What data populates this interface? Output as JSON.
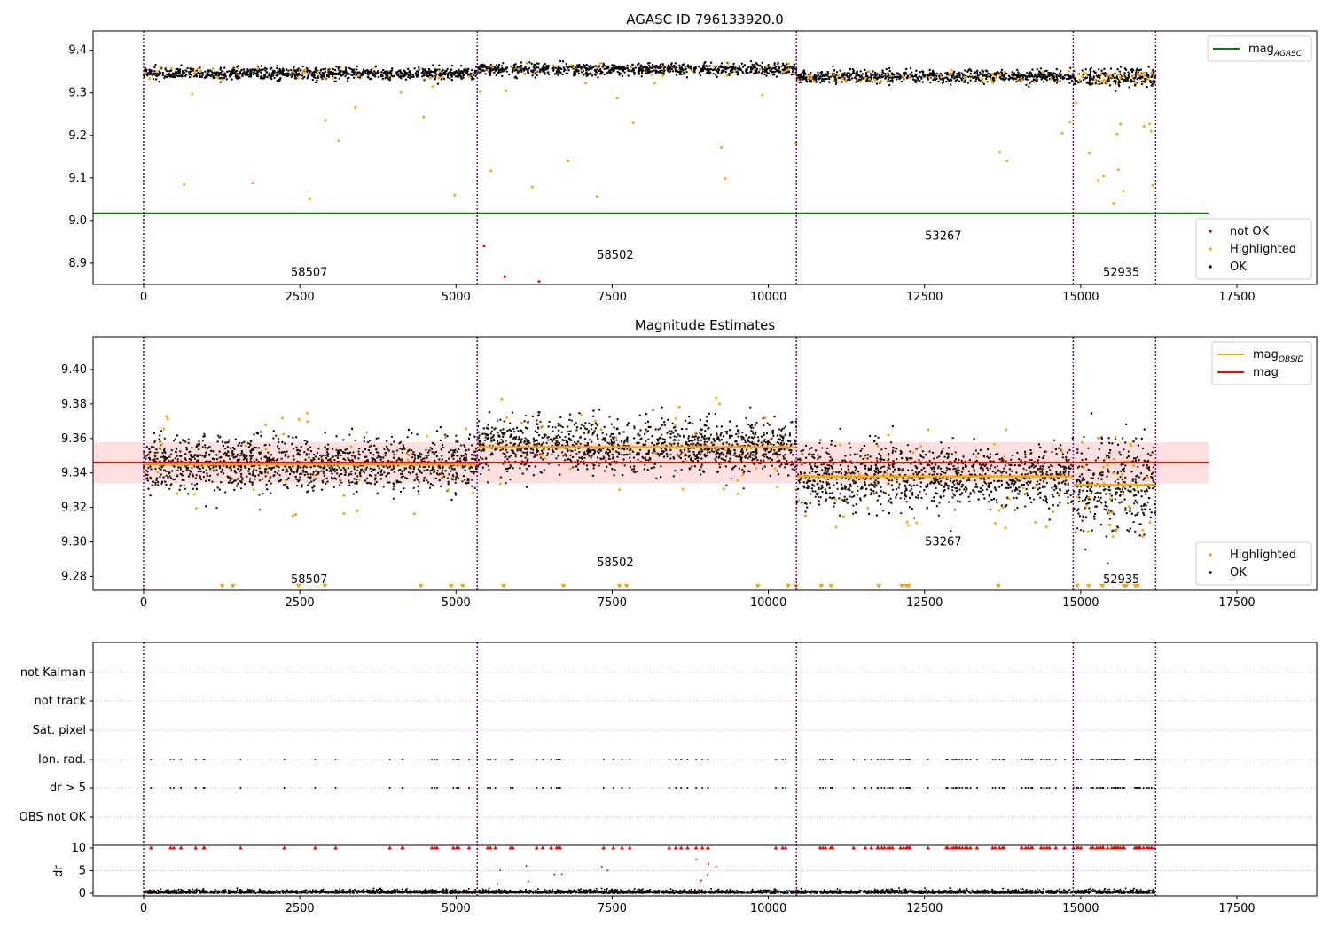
{
  "chart_data": [
    {
      "type": "scatter",
      "title": "AGASC ID 796133920.0",
      "xlim": [
        -800,
        18700
      ],
      "ylim": [
        8.85,
        9.445
      ],
      "xticks": [
        0,
        2500,
        5000,
        7500,
        10000,
        12500,
        15000,
        17500
      ],
      "yticks": [
        8.9,
        9.0,
        9.1,
        9.2,
        9.3,
        9.4
      ],
      "legend_lines": [
        {
          "label": "mag",
          "sub": "AGASC",
          "color": "#008000"
        }
      ],
      "legend_points": [
        {
          "label": "not OK",
          "color": "#ff0000"
        },
        {
          "label": "Highlighted",
          "color": "#ffa500"
        },
        {
          "label": "OK",
          "color": "#000000"
        }
      ],
      "mag_agasc": 9.017,
      "agasc_line_end": 17050
    },
    {
      "type": "scatter",
      "title": "Magnitude Estimates",
      "xlim": [
        -800,
        18700
      ],
      "ylim": [
        9.272,
        9.419
      ],
      "xticks": [
        0,
        2500,
        5000,
        7500,
        10000,
        12500,
        15000,
        17500
      ],
      "yticks": [
        9.28,
        9.3,
        9.32,
        9.34,
        9.36,
        9.38,
        9.4
      ],
      "legend_lines": [
        {
          "label": "mag",
          "sub": "OBSID",
          "color": "#ffa500"
        },
        {
          "label": "mag",
          "sub": "",
          "color": "#ff0000"
        }
      ],
      "legend_points": [
        {
          "label": "Highlighted",
          "color": "#ffa500"
        },
        {
          "label": "OK",
          "color": "#000000"
        }
      ],
      "mag": 9.346,
      "mag_band": [
        9.334,
        9.358
      ],
      "mag_line_end": 17050
    },
    {
      "type": "scatter",
      "xlim": [
        -800,
        18700
      ],
      "xticks": [
        0,
        2500,
        5000,
        7500,
        10000,
        12500,
        15000,
        17500
      ],
      "flag_labels": [
        "not Kalman",
        "not track",
        "Sat. pixel",
        "Ion. rad.",
        "dr > 5",
        "OBS not OK"
      ],
      "dr_ylabel": "dr",
      "dr_yticks": [
        0,
        5,
        10
      ]
    }
  ],
  "obsids": [
    {
      "id": "58507",
      "start": 0,
      "end": 5340,
      "mag": 9.345,
      "label_x": 2650
    },
    {
      "id": "58502",
      "start": 5340,
      "end": 10450,
      "mag": 9.355,
      "label_x": 7550
    },
    {
      "id": "53267",
      "start": 10450,
      "end": 14880,
      "mag": 9.338,
      "label_x": 12800
    },
    {
      "id": "52935",
      "start": 14880,
      "end": 16200,
      "mag": 9.333,
      "label_x": 15650
    }
  ],
  "obsid_boundaries": [
    0,
    5340,
    10450,
    14880,
    16200
  ],
  "colors": {
    "ok": "#000000",
    "highlighted": "#ffa500",
    "not_ok": "#ff0000",
    "boundary": "#800080"
  }
}
